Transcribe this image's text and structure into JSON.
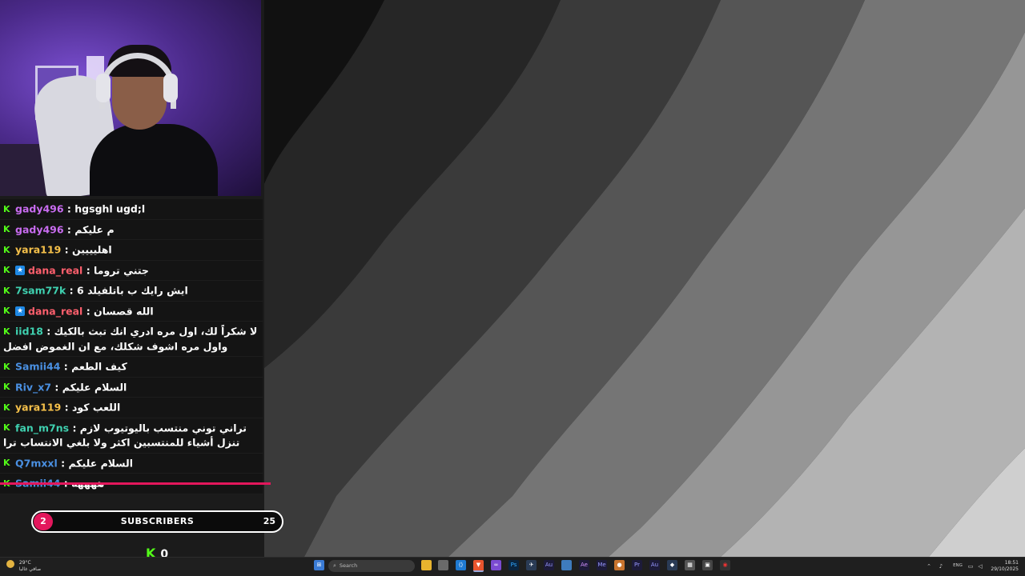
{
  "chat": {
    "messages": [
      {
        "user": "gady496",
        "color": "#c86cf0",
        "badge": false,
        "text": "hgsghl ugd;l"
      },
      {
        "user": "gady496",
        "color": "#c86cf0",
        "badge": false,
        "text": "م عليكم"
      },
      {
        "user": "yara119",
        "color": "#f5c04a",
        "badge": false,
        "text": "اهليييين"
      },
      {
        "user": "dana_real",
        "color": "#ff5f6d",
        "badge": true,
        "text": "جتني تروما"
      },
      {
        "user": "7sam77k",
        "color": "#3fd1b0",
        "badge": false,
        "text": "ايش رايك ب باتلفيلد 6"
      },
      {
        "user": "dana_real",
        "color": "#ff5f6d",
        "badge": true,
        "text": "الله قصسان"
      },
      {
        "user": "iid18",
        "color": "#3fd1b0",
        "badge": false,
        "text": "لا شكراً لك، اول مره ادري انك تبث بالكيك واول مره اشوف شكلك، مع ان الغموض افضل"
      },
      {
        "user": "Samii44",
        "color": "#4a90e2",
        "badge": false,
        "text": "كيف الطعم"
      },
      {
        "user": "Riv_x7",
        "color": "#4a90e2",
        "badge": false,
        "text": "السلام عليكم"
      },
      {
        "user": "yara119",
        "color": "#f5c04a",
        "badge": false,
        "text": "اللعب كود"
      },
      {
        "user": "fan_m7ns",
        "color": "#3fd1b0",
        "badge": false,
        "text": "تراني توني منتسب باليوتيوب لازم تنزل أشياء للمنتسبين اكثر ولا بلغي الانتساب ترا"
      },
      {
        "user": "Q7mxxl",
        "color": "#4a90e2",
        "badge": false,
        "text": "السلام عليكم"
      },
      {
        "user": "Samii44",
        "color": "#4a90e2",
        "badge": false,
        "text": "ههههه"
      }
    ]
  },
  "subscribers": {
    "current": "2",
    "label": "SUBSCRIBERS",
    "goal": "25",
    "progress": 0.08
  },
  "kick": {
    "count": "0"
  },
  "taskbar": {
    "weather_temp": "29°C",
    "weather_desc": "صافي غالبا",
    "search_placeholder": "Search",
    "lang": "ENG",
    "time": "18:51",
    "date": "29/10/2025"
  }
}
